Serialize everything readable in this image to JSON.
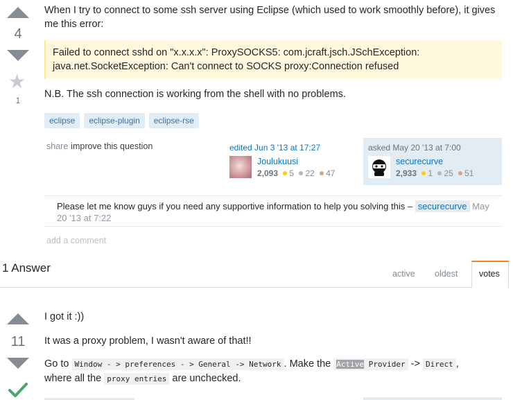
{
  "question": {
    "votes": "4",
    "favorites": "1",
    "body_line1": "When I try to connect to some ssh server using Eclipse (which used to work smoothly before), it gives",
    "body_line2": "me this error:",
    "error_line1": "Failed to connect sshd on \"x.x.x.x\": ProxySOCKS5: com.jcraft.jsch.JSchException:",
    "error_line2": "java.net.SocketException: Can't connect to SOCKS proxy:Connection refused",
    "note": "N.B. The ssh connection is working from the shell with no problems.",
    "tags": [
      "eclipse",
      "eclipse-plugin",
      "eclipse-rse"
    ],
    "menu": {
      "share": "share",
      "improve": "improve this question"
    },
    "edited": {
      "action": "edited Jun 3 '13 at 17:27",
      "user": "Joulukuusi",
      "rep": "2,093",
      "gold": "5",
      "silver": "22",
      "bronze": "47"
    },
    "asked": {
      "action": "asked May 20 '13 at 7:00",
      "user": "securecurve",
      "rep": "2,933",
      "gold": "1",
      "silver": "25",
      "bronze": "51"
    },
    "comment": {
      "text": "Please let me know guys if you need any supportive information to help you solving this –",
      "user": "securecurve",
      "date_part1": "May",
      "date_part2": "20 '13 at 7:22"
    },
    "add_comment": "add a comment"
  },
  "answers_header": {
    "title": "1 Answer",
    "tabs": [
      "active",
      "oldest",
      "votes"
    ]
  },
  "answer": {
    "votes": "11",
    "line1": "I got it :))",
    "line2": "It was a proxy problem, I wasn't aware of that!!",
    "goto": "Go to",
    "code_path": "Window - > preferences - > General -> Network",
    "make_the": ". Make the",
    "code_active": "Active",
    "code_provider": " Provider",
    "arrow": "->",
    "code_direct": "Direct",
    "comma": ",",
    "where_all": "where all the",
    "code_proxy": "proxy entries",
    "are_unchecked": "are unchecked."
  }
}
